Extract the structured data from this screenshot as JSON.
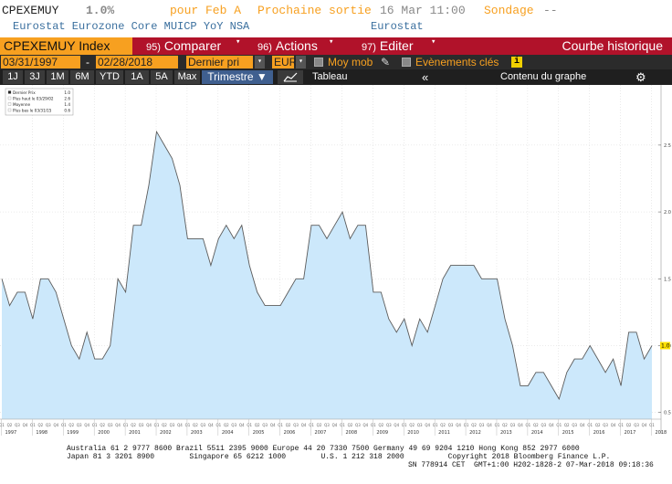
{
  "header": {
    "ticker": "CPEXEMUY",
    "value": "1.0%",
    "period": "pour Feb A",
    "next_release_label": "Prochaine sortie",
    "next_release_value": "16 Mar 11:00",
    "survey_label": "Sondage",
    "survey_value": "--",
    "description": "Eurostat Eurozone Core MUICP YoY NSA",
    "source": "Eurostat"
  },
  "toolbar": {
    "index_label": "CPEXEMUY Index",
    "compare": {
      "num": "95)",
      "label": "Comparer"
    },
    "actions": {
      "num": "96)",
      "label": "Actions"
    },
    "edit": {
      "num": "97)",
      "label": "Editer"
    },
    "view_title": "Courbe historique"
  },
  "settings": {
    "start_date": "03/31/1997",
    "separator": "-",
    "end_date": "02/28/2018",
    "field": "Dernier pri",
    "currency": "EUR",
    "moving_avg_label": "Moy mob",
    "events_label": "Evènements clés",
    "info": "i"
  },
  "range_bar": {
    "ranges": [
      "1J",
      "3J",
      "1M",
      "6M",
      "YTD",
      "1A",
      "5A",
      "Max"
    ],
    "frequency": "Trimestre ▼",
    "table_label": "Tableau",
    "collapse": "«",
    "content_label": "Contenu du graphe",
    "settings_icon": "gear-icon"
  },
  "chart_data": {
    "type": "area",
    "legend": [
      {
        "label": "Dernier Prix",
        "value": "1.0"
      },
      {
        "label": "Plus haut le 03/29/02",
        "value": "2.6"
      },
      {
        "label": "Moyenne",
        "value": "1.4"
      },
      {
        "label": "Plus bas le 03/31/15",
        "value": "0.6"
      }
    ],
    "current_value_label": "1.0",
    "ylim": [
      0.45,
      2.95
    ],
    "y_ticks": [
      "0.5",
      "1.0",
      "1.5",
      "2.0",
      "2.5"
    ],
    "years": [
      "1997",
      "1998",
      "1999",
      "2000",
      "2001",
      "2002",
      "2003",
      "2004",
      "2005",
      "2006",
      "2007",
      "2008",
      "2009",
      "2010",
      "2011",
      "2012",
      "2013",
      "2014",
      "2015",
      "2016",
      "2017",
      "2018"
    ],
    "x_start": "1997-03-31",
    "quarter_labels": [
      "Q1",
      "Q2",
      "Q3",
      "Q4"
    ],
    "values": [
      1.5,
      1.3,
      1.4,
      1.4,
      1.2,
      1.5,
      1.5,
      1.4,
      1.2,
      1.0,
      0.9,
      1.1,
      0.9,
      0.9,
      1.0,
      1.5,
      1.4,
      1.9,
      1.9,
      2.2,
      2.6,
      2.5,
      2.4,
      2.2,
      1.8,
      1.8,
      1.8,
      1.6,
      1.8,
      1.9,
      1.8,
      1.9,
      1.6,
      1.4,
      1.3,
      1.3,
      1.3,
      1.4,
      1.5,
      1.5,
      1.9,
      1.9,
      1.8,
      1.9,
      2.0,
      1.8,
      1.9,
      1.9,
      1.4,
      1.4,
      1.2,
      1.1,
      1.2,
      1.0,
      1.2,
      1.1,
      1.3,
      1.5,
      1.6,
      1.6,
      1.6,
      1.6,
      1.5,
      1.5,
      1.5,
      1.2,
      1.0,
      0.7,
      0.7,
      0.8,
      0.8,
      0.7,
      0.6,
      0.8,
      0.9,
      0.9,
      1.0,
      0.9,
      0.8,
      0.9,
      0.7,
      1.1,
      1.1,
      0.9,
      1.0
    ],
    "colors": {
      "fill": "#cce8fb",
      "line": "#5b5b5b",
      "grid": "#d6d6d6"
    }
  },
  "footer": {
    "line1": "Australia 61 2 9777 8600 Brazil 5511 2395 9000 Europe 44 20 7330 7500 Germany 49 69 9204 1210 Hong Kong 852 2977 6000",
    "line2": "Japan 81 3 3201 8900        Singapore 65 6212 1000        U.S. 1 212 318 2000          Copyright 2018 Bloomberg Finance L.P.",
    "line3": "SN 778914 CET  GMT+1:00 H202-1828-2 07-Mar-2018 09:18:36"
  }
}
